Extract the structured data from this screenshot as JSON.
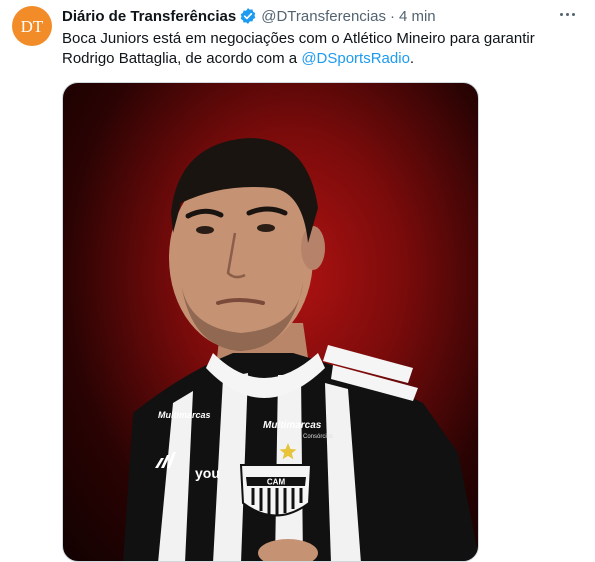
{
  "tweet": {
    "avatar_icon": "dt-logo-icon",
    "avatar_text": "DT",
    "author_name": "Diário de Transferências",
    "verified_icon": "verified-badge-icon",
    "handle": "@DTransferencias",
    "separator": "·",
    "time": "4 min",
    "more_icon": "more-options-icon",
    "text_before": "Boca Juniors está em negociações com o Atlético Mineiro para garantir Rodrigo Battaglia, de acordo com a ",
    "mention": "@DSportsRadio",
    "text_after": ".",
    "accent_color": "#1d9bf0"
  },
  "media": {
    "description_kind": "player-photo",
    "shirt_sponsor": "Multimarcas",
    "shirt_sponsor_sub": "Consórcios",
    "shirt_brand": "you",
    "crest_text": "CAM"
  }
}
